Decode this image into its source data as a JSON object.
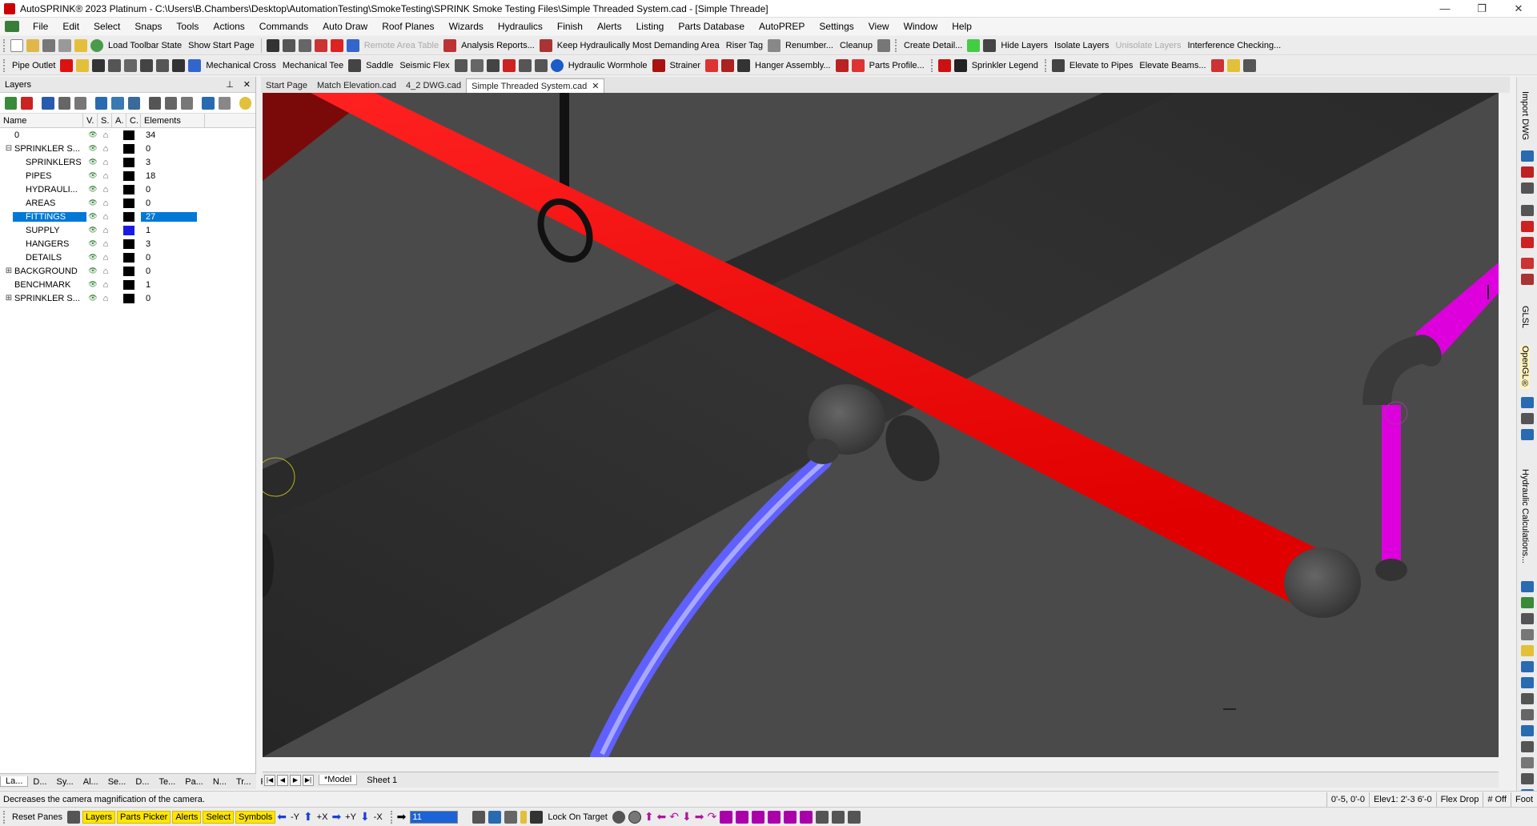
{
  "window": {
    "title": "AutoSPRINK® 2023 Platinum - C:\\Users\\B.Chambers\\Desktop\\AutomationTesting\\SmokeTesting\\SPRINK Smoke Testing Files\\Simple Threaded System.cad - [Simple Threade]",
    "minimize": "—",
    "restore": "❐",
    "close": "✕"
  },
  "menu": [
    "File",
    "Edit",
    "Select",
    "Snaps",
    "Tools",
    "Actions",
    "Commands",
    "Auto Draw",
    "Roof Planes",
    "Wizards",
    "Hydraulics",
    "Finish",
    "Alerts",
    "Listing",
    "Parts Database",
    "AutoPREP",
    "Settings",
    "View",
    "Window",
    "Help"
  ],
  "toolbar1": {
    "load_toolbar_state": "Load Toolbar State",
    "show_start_page": "Show Start Page",
    "remote_area_table": "Remote Area Table",
    "analysis_reports": "Analysis Reports...",
    "keep_hydraulically": "Keep Hydraulically Most Demanding Area",
    "riser_tag": "Riser Tag",
    "renumber": "Renumber...",
    "cleanup": "Cleanup",
    "create_detail": "Create Detail...",
    "hide_layers": "Hide Layers",
    "isolate_layers": "Isolate Layers",
    "unisolate_layers": "Unisolate Layers",
    "interference_checking": "Interference Checking..."
  },
  "toolbar2": {
    "pipe_outlet": "Pipe Outlet",
    "mechanical_cross": "Mechanical Cross",
    "mechanical_tee": "Mechanical Tee",
    "saddle": "Saddle",
    "seismic_flex": "Seismic Flex",
    "hydraulic_wormhole": "Hydraulic Wormhole",
    "strainer": "Strainer",
    "hanger_assembly": "Hanger Assembly...",
    "parts_profile": "Parts Profile...",
    "sprinkler_legend": "Sprinkler Legend",
    "elevate_to_pipes": "Elevate to Pipes",
    "elevate_beams": "Elevate Beams..."
  },
  "layers_panel": {
    "title": "Layers",
    "pin": "⊥",
    "close": "✕",
    "columns": {
      "name": "Name",
      "v": "V.",
      "s": "S.",
      "a": "A.",
      "c": "C.",
      "elements": "Elements"
    },
    "rows": [
      {
        "name": "0",
        "count": "34",
        "expander": "",
        "indent": 0,
        "color": "#000000",
        "selected": false
      },
      {
        "name": "SPRINKLER S...",
        "count": "0",
        "expander": "⊟",
        "indent": 0,
        "color": "#000000",
        "selected": false
      },
      {
        "name": "SPRINKLERS",
        "count": "3",
        "expander": "",
        "indent": 1,
        "color": "#000000",
        "selected": false
      },
      {
        "name": "PIPES",
        "count": "18",
        "expander": "",
        "indent": 1,
        "color": "#000000",
        "selected": false
      },
      {
        "name": "HYDRAULI...",
        "count": "0",
        "expander": "",
        "indent": 1,
        "color": "#000000",
        "selected": false
      },
      {
        "name": "AREAS",
        "count": "0",
        "expander": "",
        "indent": 1,
        "color": "#000000",
        "selected": false
      },
      {
        "name": "FITTINGS",
        "count": "27",
        "expander": "",
        "indent": 1,
        "color": "#000000",
        "selected": true
      },
      {
        "name": "SUPPLY",
        "count": "1",
        "expander": "",
        "indent": 1,
        "color": "#1a1ae6",
        "selected": false
      },
      {
        "name": "HANGERS",
        "count": "3",
        "expander": "",
        "indent": 1,
        "color": "#000000",
        "selected": false
      },
      {
        "name": "DETAILS",
        "count": "0",
        "expander": "",
        "indent": 1,
        "color": "#000000",
        "selected": false
      },
      {
        "name": "BACKGROUND",
        "count": "0",
        "expander": "⊞",
        "indent": 0,
        "color": "#000000",
        "selected": false
      },
      {
        "name": "BENCHMARK",
        "count": "1",
        "expander": "",
        "indent": 0,
        "color": "#000000",
        "selected": false
      },
      {
        "name": "SPRINKLER S...",
        "count": "0",
        "expander": "⊞",
        "indent": 0,
        "color": "#000000",
        "selected": false
      }
    ],
    "bottom_tabs": [
      "La...",
      "D...",
      "Sy...",
      "Al...",
      "Se...",
      "D...",
      "Te...",
      "Pa...",
      "N...",
      "Tr...",
      "Fa..."
    ]
  },
  "doc_tabs": [
    {
      "label": "Start Page",
      "active": false
    },
    {
      "label": "Match Elevation.cad",
      "active": false
    },
    {
      "label": "4_2 DWG.cad",
      "active": false
    },
    {
      "label": "Simple Threaded System.cad",
      "active": true
    }
  ],
  "doc_tab_close": "✕",
  "sheet_tabs": [
    {
      "label": "*Model",
      "active": true
    },
    {
      "label": "Sheet 1",
      "active": false
    }
  ],
  "right_dock": {
    "import_dwg": "Import DWG",
    "glsl": "GLSL",
    "opengl": "OpenGL®",
    "hydraulic_calculations": "Hydraulic Calculations..."
  },
  "status": {
    "hint": "Decreases the camera magnification of the camera.",
    "coords": "0'-5, 0'-0",
    "elev": "Elev1: 2'-3  6'-0",
    "flex_drop": "Flex Drop",
    "off": "# Off",
    "units": "Foot"
  },
  "bottom_toolbar": {
    "reset_panes": "Reset Panes",
    "layers": "Layers",
    "parts_picker": "Parts Picker",
    "alerts": "Alerts",
    "select": "Select",
    "symbols": "Symbols",
    "neg_y": "-Y",
    "pos_y": "+Y",
    "pos_x": "+X",
    "neg_x": "-X",
    "zoom_value": "11",
    "lock_on_target": "Lock On Target"
  },
  "colors": {
    "red_pipe": "#ff0000",
    "magenta_pipe": "#e000e0",
    "blue_flex": "#5a5aff",
    "beam": "#2e2e2e",
    "viewport_bg": "#4a4a4a",
    "selection": "#0078d7"
  }
}
